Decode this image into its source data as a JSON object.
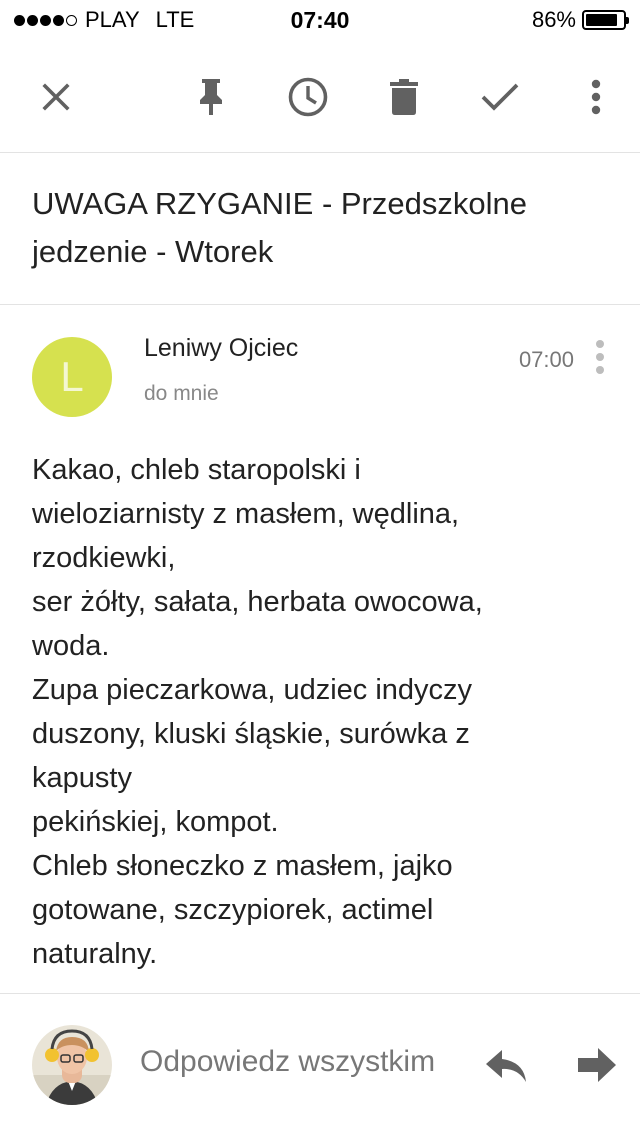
{
  "status_bar": {
    "carrier": "PLAY",
    "network": "LTE",
    "time": "07:40",
    "battery_percent": "86%",
    "battery_level": 0.86,
    "signal_bars": 4,
    "signal_max": 5
  },
  "toolbar": {
    "icons": [
      "close-icon",
      "pin-icon",
      "snooze-clock-icon",
      "trash-icon",
      "done-check-icon",
      "more-vert-icon"
    ]
  },
  "email": {
    "subject": "UWAGA RZYGANIE - Przedszkolne jedzenie - Wtorek",
    "sender_initial": "L",
    "sender_name": "Leniwy Ojciec",
    "recipient": "do mnie",
    "time": "07:00",
    "body_lines": [
      "Kakao, chleb staropolski i",
      "wieloziarnisty z masłem, wędlina,",
      "rzodkiewki,",
      "ser żółty, sałata, herbata owocowa,",
      "woda.",
      "Zupa pieczarkowa, udziec indyczy",
      "duszony, kluski śląskie, surówka z",
      "kapusty",
      "pekińskiej, kompot.",
      "Chleb słoneczko z masłem, jajko",
      "gotowane, szczypiorek, actimel",
      "naturalny."
    ]
  },
  "reply_bar": {
    "reply_all_label": "Odpowiedz wszystkim"
  },
  "colors": {
    "avatar_bg": "#d6e14f",
    "icon_gray": "#616161",
    "divider": "#e3e3e3"
  }
}
